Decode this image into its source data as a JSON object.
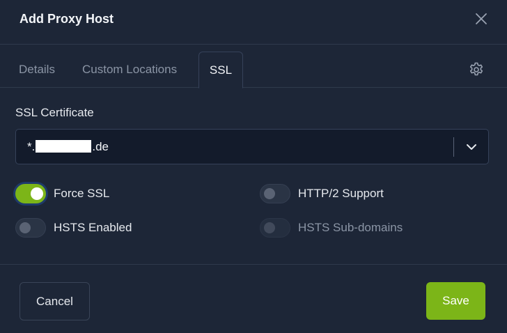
{
  "dialog": {
    "title": "Add Proxy Host"
  },
  "tabs": [
    {
      "label": "Details",
      "active": false
    },
    {
      "label": "Custom Locations",
      "active": false
    },
    {
      "label": "SSL",
      "active": true
    }
  ],
  "ssl": {
    "certificate_label": "SSL Certificate",
    "certificate_prefix": "*.",
    "certificate_suffix": ".de"
  },
  "toggles": {
    "force_ssl": {
      "label": "Force SSL",
      "checked": true,
      "disabled": false
    },
    "http2": {
      "label": "HTTP/2 Support",
      "checked": false,
      "disabled": false
    },
    "hsts": {
      "label": "HSTS Enabled",
      "checked": false,
      "disabled": false
    },
    "hsts_subdomains": {
      "label": "HSTS Sub-domains",
      "checked": false,
      "disabled": true
    }
  },
  "footer": {
    "cancel_label": "Cancel",
    "save_label": "Save"
  },
  "colors": {
    "background": "#1d2637",
    "accent": "#7cb518",
    "input_bg": "#131b2b"
  },
  "icons": [
    "close-icon",
    "gear-icon",
    "chevron-down-icon"
  ]
}
